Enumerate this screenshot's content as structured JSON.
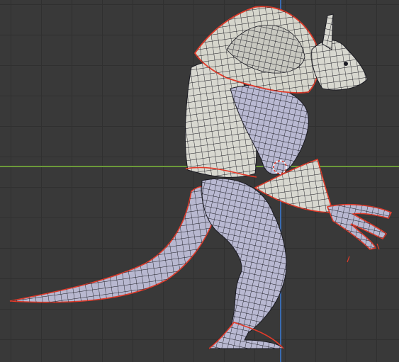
{
  "viewport": {
    "view": "side-orthographic",
    "colors": {
      "background": "#393939",
      "grid": "#303030",
      "x_axis": "#6c9a3a",
      "z_axis": "#3a6bb0",
      "mesh_fill": "#b9b9d2",
      "mesh_fill_light": "#d8d8d0",
      "wire": "#1a1a22",
      "seam": "#e23b2a"
    },
    "object": {
      "type": "creature-mesh",
      "mode": "edit",
      "display": "wireframe-over-solid",
      "uv_seams": "red"
    },
    "cursor": "3d-cursor"
  }
}
